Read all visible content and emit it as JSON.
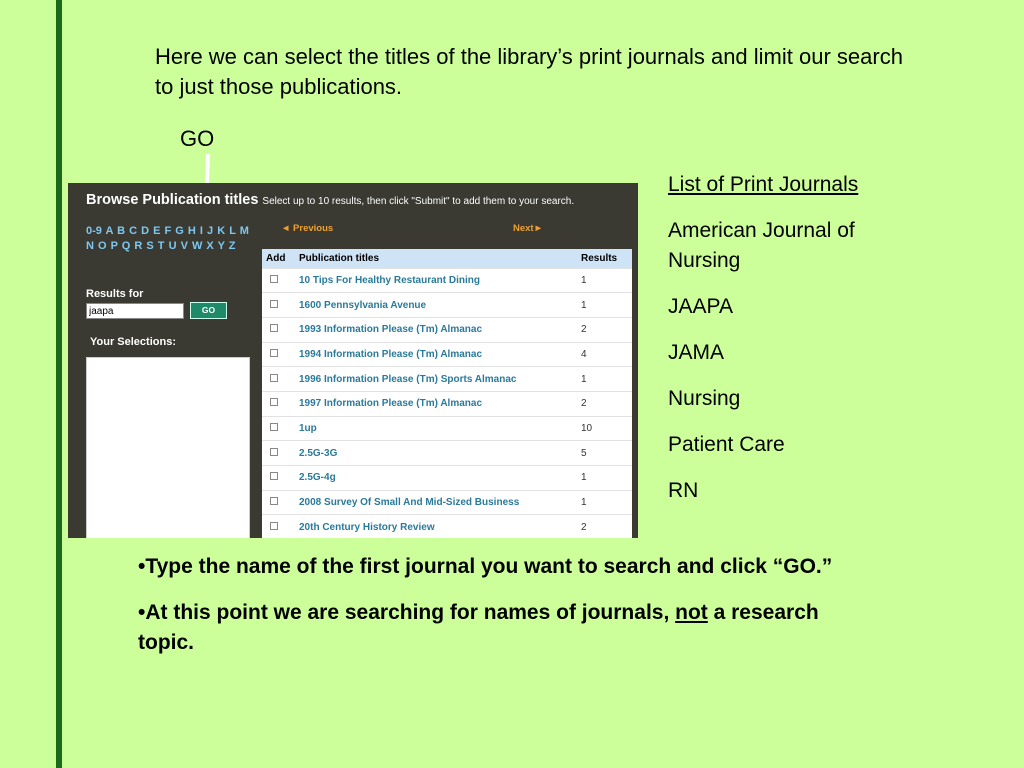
{
  "intro": {
    "text": "Here we can select the titles of the library’s print journals and limit our search to just those publications."
  },
  "callout": {
    "go_label": "GO"
  },
  "screenshot": {
    "title": "Browse Publication titles",
    "subtitle": "Select up to 10 results, then click \"Submit\" to add them to your search.",
    "prev_label": "Previous",
    "next_label": "Next",
    "az_index": "0-9 A B C D E F G H I J K L M N O P Q R S T U V W X Y Z",
    "results_for_label": "Results for",
    "search_value": "jaapa",
    "go_button": "GO",
    "selections_label": "Your Selections:",
    "columns": {
      "add": "Add",
      "title": "Publication titles",
      "results": "Results"
    },
    "rows": [
      {
        "title": "10 Tips For Healthy Restaurant Dining",
        "results": "1"
      },
      {
        "title": "1600 Pennsylvania Avenue",
        "results": "1"
      },
      {
        "title": "1993 Information Please (Tm) Almanac",
        "results": "2"
      },
      {
        "title": "1994 Information Please (Tm) Almanac",
        "results": "4"
      },
      {
        "title": "1996 Information Please (Tm) Sports Almanac",
        "results": "1"
      },
      {
        "title": "1997 Information Please (Tm) Almanac",
        "results": "2"
      },
      {
        "title": "1up",
        "results": "10"
      },
      {
        "title": "2.5G-3G",
        "results": "5"
      },
      {
        "title": "2.5G-4g",
        "results": "1"
      },
      {
        "title": "2008 Survey Of Small And Mid-Sized Business",
        "results": "1"
      },
      {
        "title": "20th Century History Review",
        "results": "2"
      }
    ]
  },
  "journals": {
    "heading": "List of Print Journals",
    "items": [
      "American Journal of Nursing",
      "JAAPA",
      "JAMA",
      "Nursing",
      "Patient Care",
      "RN"
    ]
  },
  "bullets": {
    "first": "•Type the name of the first journal you want to search and click “GO.”",
    "second_prefix": "•At this point we are searching for names of journals, ",
    "second_emph": "not",
    "second_suffix": " a research topic."
  },
  "colors": {
    "background": "#ccff99",
    "accent_bar": "#1a6a1a",
    "panel": "#3a3a32",
    "link": "#2a7a9a"
  }
}
